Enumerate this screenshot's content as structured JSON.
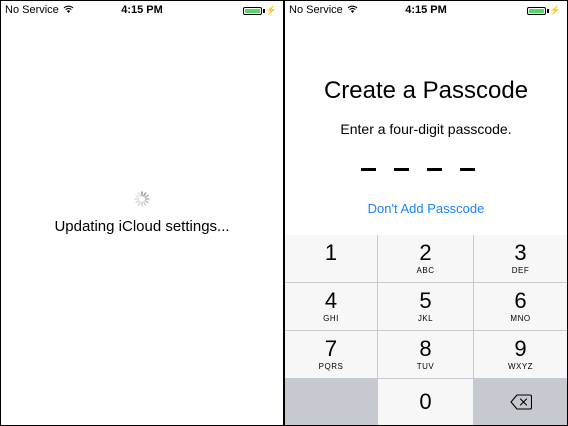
{
  "left": {
    "status": {
      "carrier": "No Service",
      "time": "4:15 PM"
    },
    "loading_text": "Updating iCloud settings..."
  },
  "right": {
    "status": {
      "carrier": "No Service",
      "time": "4:15 PM"
    },
    "title": "Create a Passcode",
    "subtitle": "Enter a four-digit passcode.",
    "skip_label": "Don't Add Passcode",
    "keys": [
      {
        "num": "1",
        "letters": ""
      },
      {
        "num": "2",
        "letters": "ABC"
      },
      {
        "num": "3",
        "letters": "DEF"
      },
      {
        "num": "4",
        "letters": "GHI"
      },
      {
        "num": "5",
        "letters": "JKL"
      },
      {
        "num": "6",
        "letters": "MNO"
      },
      {
        "num": "7",
        "letters": "PQRS"
      },
      {
        "num": "8",
        "letters": "TUV"
      },
      {
        "num": "9",
        "letters": "WXYZ"
      },
      {
        "num": "0",
        "letters": ""
      }
    ]
  },
  "colors": {
    "accent": "#1a82fb",
    "battery": "#4cd964",
    "keypad_bg": "#c6c9cf",
    "key_bg": "#f7f7f7"
  },
  "icons": [
    "wifi-icon",
    "battery-icon",
    "spinner-icon",
    "backspace-icon"
  ]
}
